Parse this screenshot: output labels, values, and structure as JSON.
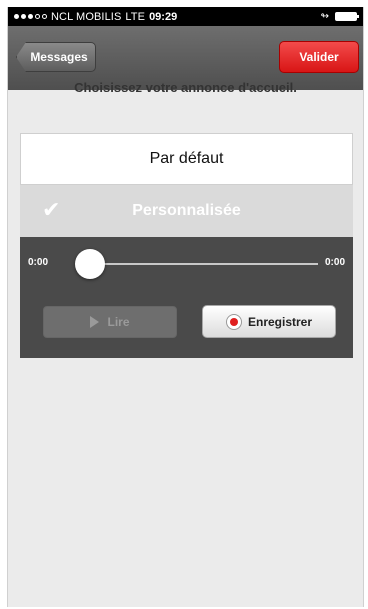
{
  "status_bar": {
    "carrier": "NCL MOBILIS",
    "network": "LTE",
    "time": "09:29"
  },
  "nav": {
    "back_label": "Messages",
    "confirm_label": "Valider"
  },
  "instruction": "Choisissez votre annonce d'accueil.",
  "options": [
    {
      "label": "Par défaut",
      "selected": false
    },
    {
      "label": "Personnalisée",
      "selected": true
    }
  ],
  "player": {
    "current_time": "0:00",
    "total_time": "0:00",
    "progress": 0,
    "play_label": "Lire",
    "record_label": "Enregistrer"
  },
  "colors": {
    "accent_red": "#d81515",
    "nav_gray": "#5d5d5d",
    "player_bg": "#4a4a4a"
  }
}
